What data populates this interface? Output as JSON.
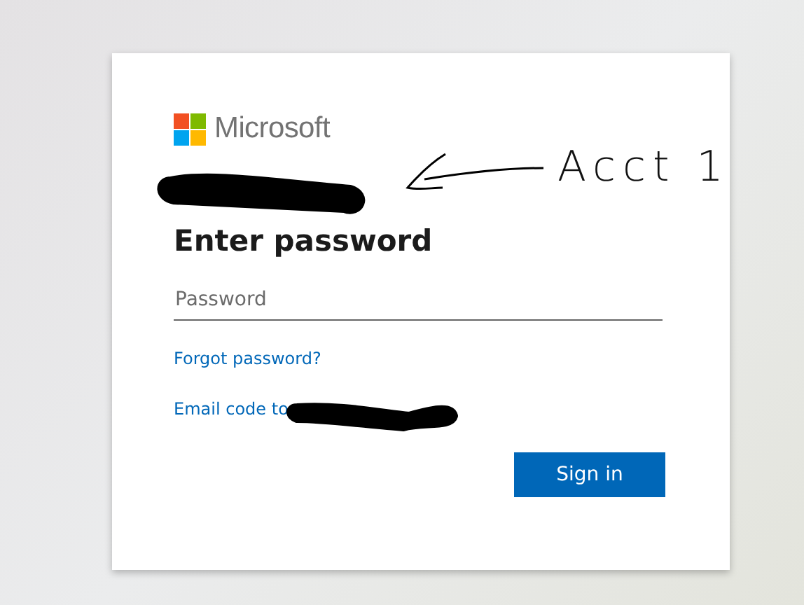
{
  "logo": {
    "wordmark": "Microsoft"
  },
  "heading": "Enter password",
  "password_field": {
    "placeholder": "Password"
  },
  "links": [
    {
      "label": "Forgot password?"
    },
    {
      "label": "Email code to"
    }
  ],
  "sign_in_button": {
    "label": "Sign in"
  },
  "annotation": {
    "text": "Acct 1"
  }
}
